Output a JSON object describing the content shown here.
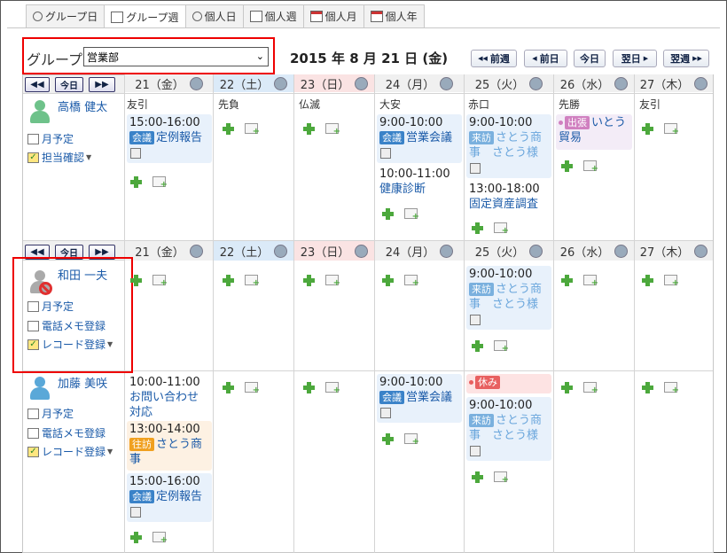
{
  "tabs": [
    {
      "label": "グループ日",
      "icon": "group-day-icon"
    },
    {
      "label": "グループ週",
      "icon": "group-week-icon"
    },
    {
      "label": "個人日",
      "icon": "personal-day-icon"
    },
    {
      "label": "個人週",
      "icon": "personal-week-icon"
    },
    {
      "label": "個人月",
      "icon": "personal-month-icon"
    },
    {
      "label": "個人年",
      "icon": "personal-year-icon"
    }
  ],
  "active_tab": "グループ週",
  "group": {
    "label": "グループ",
    "selected": "営業部"
  },
  "date_title": "2015 年 8 月 21 日 (金)",
  "nav": {
    "prev_week": "前週",
    "prev_day": "前日",
    "today": "今日",
    "next_day": "翌日",
    "next_week": "翌週"
  },
  "mini_nav": {
    "prev": "◀◀",
    "today": "今日",
    "next": "▶▶"
  },
  "days": [
    {
      "label": "21（金）",
      "rokuyo": "友引",
      "kind": "weekday"
    },
    {
      "label": "22（土）",
      "rokuyo": "先負",
      "kind": "sat"
    },
    {
      "label": "23（日）",
      "rokuyo": "仏滅",
      "kind": "sun"
    },
    {
      "label": "24（月）",
      "rokuyo": "大安",
      "kind": "weekday"
    },
    {
      "label": "25（火）",
      "rokuyo": "赤口",
      "kind": "weekday"
    },
    {
      "label": "26（水）",
      "rokuyo": "先勝",
      "kind": "weekday"
    },
    {
      "label": "27（木）",
      "rokuyo": "友引",
      "kind": "weekday"
    }
  ],
  "users": [
    {
      "name": "高橋 健太",
      "links": [
        "月予定",
        "担当確認"
      ],
      "avatar_color": "#6ec28a"
    },
    {
      "name": "和田 一夫",
      "links": [
        "月予定",
        "電話メモ登録",
        "レコード登録"
      ],
      "avatar_color": "#aaaaaa"
    },
    {
      "name": "加藤 美咲",
      "links": [
        "月予定",
        "電話メモ登録",
        "レコード登録"
      ],
      "avatar_color": "#5aa8d8"
    }
  ],
  "events": {
    "u1_d1": {
      "time": "15:00-16:00",
      "badge": "会議",
      "title": "定例報告"
    },
    "u1_d4a": {
      "time": "9:00-10:00",
      "badge": "会議",
      "title": "営業会議"
    },
    "u1_d4b": {
      "time": "10:00-11:00",
      "title": "健康診断"
    },
    "u1_d5a": {
      "time": "9:00-10:00",
      "badge": "来訪",
      "title": "さとう商事　さとう様"
    },
    "u1_d5b": {
      "time": "13:00-18:00",
      "title": "固定資産調査"
    },
    "u1_d6": {
      "badge": "出張",
      "title": "いとう貿易"
    },
    "u2_d5": {
      "time": "9:00-10:00",
      "badge": "来訪",
      "title": "さとう商事　さとう様"
    },
    "u3_d1a": {
      "time": "10:00-11:00",
      "title": "お問い合わせ対応"
    },
    "u3_d1b": {
      "time": "13:00-14:00",
      "badge": "往訪",
      "title": "さとう商事"
    },
    "u3_d1c": {
      "time": "15:00-16:00",
      "badge": "会議",
      "title": "定例報告"
    },
    "u3_d4": {
      "time": "9:00-10:00",
      "badge": "会議",
      "title": "営業会議"
    },
    "u3_d5a": {
      "badge": "休み"
    },
    "u3_d5b": {
      "time": "9:00-10:00",
      "badge": "来訪",
      "title": "さとう商事　さとう様"
    }
  }
}
